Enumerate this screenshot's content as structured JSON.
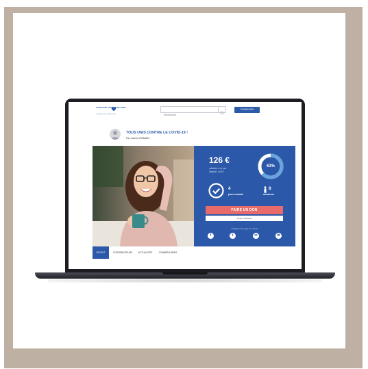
{
  "header": {
    "logo_line1": "FONDATION HOPITAUX",
    "logo_line2": "DE PARIS",
    "logo_tag": "Fondation pour la Recherche",
    "search_placeholder": "Rechercher",
    "connect_label": "CONNEXION"
  },
  "project": {
    "title": "TOUS UNIS CONTRE LE COVID-19 !",
    "author": "Par Joanne ROMAIN"
  },
  "stats": {
    "amount": "126 €",
    "collected": "collectés à ce jour",
    "goal": "Objectif : 200 €",
    "percent_label": "63%",
    "percent_value": 0.63,
    "days_remaining": "4",
    "days_label": "jours restants",
    "donors": "8",
    "donors_label": "donateurs"
  },
  "actions": {
    "give_label": "FAIRE UN DON",
    "project_type": "Projet individuel",
    "share_text": "Partager cette page de collecte"
  },
  "social": [
    {
      "name": "facebook-icon",
      "glyph": "f"
    },
    {
      "name": "twitter-icon",
      "glyph": "t"
    },
    {
      "name": "linkedin-icon",
      "glyph": "in"
    },
    {
      "name": "email-icon",
      "glyph": "✉"
    }
  ],
  "tabs": [
    {
      "label": "PROJET",
      "active": true
    },
    {
      "label": "CONTRIBUTEURS",
      "active": false
    },
    {
      "label": "ACTUALITÉS",
      "active": false
    },
    {
      "label": "COMMENTAIRES",
      "active": false
    }
  ],
  "colors": {
    "frame": "#bfb0a4",
    "brand_blue": "#2b58a8",
    "donate_red": "#e86a6a"
  }
}
